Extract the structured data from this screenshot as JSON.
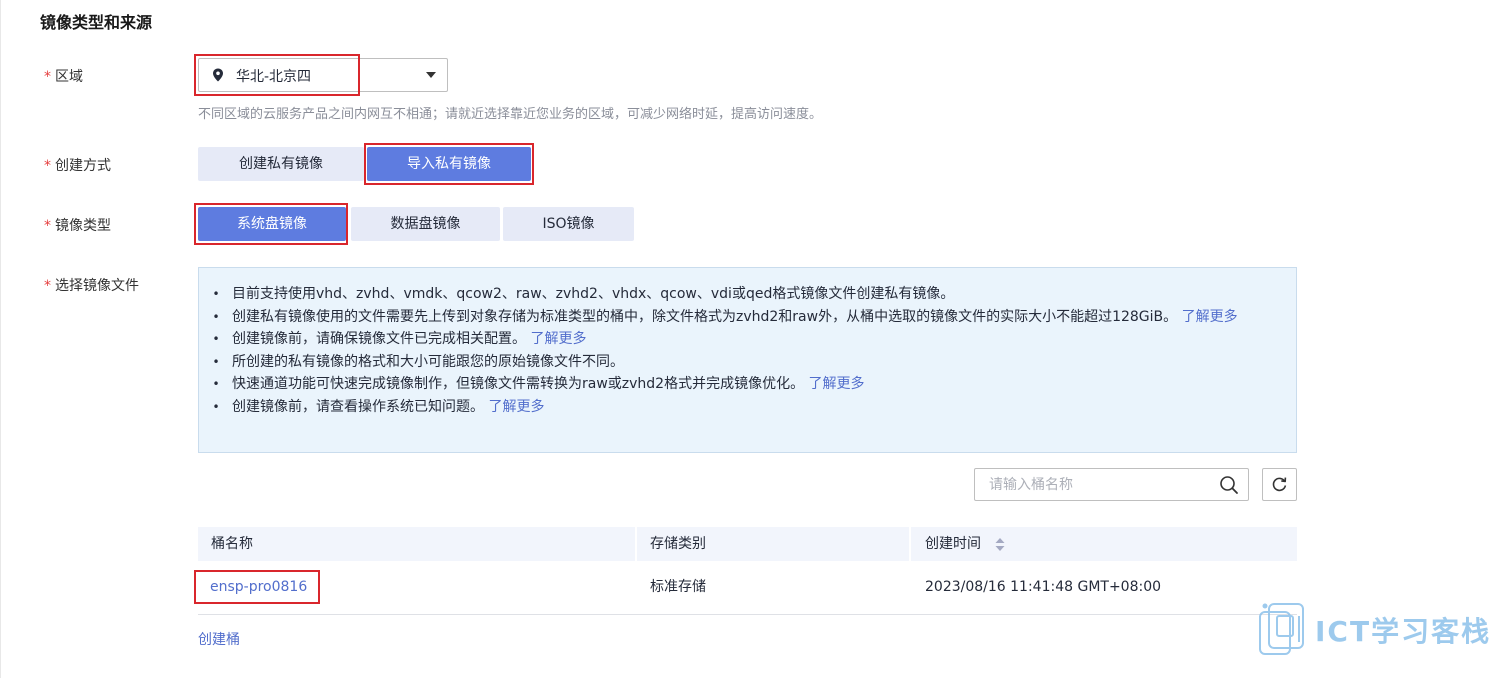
{
  "section_title": "镜像类型和来源",
  "required_mark": "*",
  "region": {
    "label": "区域",
    "value": "华北-北京四",
    "hint": "不同区域的云服务产品之间内网互不相通；请就近选择靠近您业务的区域，可减少网络时延，提高访问速度。"
  },
  "creation_method": {
    "label": "创建方式",
    "options": [
      "创建私有镜像",
      "导入私有镜像"
    ],
    "selected": "导入私有镜像"
  },
  "image_type": {
    "label": "镜像类型",
    "options": [
      "系统盘镜像",
      "数据盘镜像",
      "ISO镜像"
    ],
    "selected": "系统盘镜像"
  },
  "image_file": {
    "label": "选择镜像文件",
    "info_items": [
      {
        "text": "目前支持使用vhd、zvhd、vmdk、qcow2、raw、zvhd2、vhdx、qcow、vdi或qed格式镜像文件创建私有镜像。",
        "link": ""
      },
      {
        "text": "创建私有镜像使用的文件需要先上传到对象存储为标准类型的桶中，除文件格式为zvhd2和raw外，从桶中选取的镜像文件的实际大小不能超过128GiB。 ",
        "link": "了解更多"
      },
      {
        "text": "创建镜像前，请确保镜像文件已完成相关配置。 ",
        "link": "了解更多"
      },
      {
        "text": "所创建的私有镜像的格式和大小可能跟您的原始镜像文件不同。",
        "link": ""
      },
      {
        "text": "快速通道功能可快速完成镜像制作，但镜像文件需转换为raw或zvhd2格式并完成镜像优化。 ",
        "link": "了解更多"
      },
      {
        "text": "创建镜像前，请查看操作系统已知问题。 ",
        "link": "了解更多"
      }
    ]
  },
  "search": {
    "placeholder": "请输入桶名称",
    "value": ""
  },
  "table": {
    "columns": [
      "桶名称",
      "存储类别",
      "创建时间"
    ],
    "rows": [
      {
        "name": "ensp-pro0816",
        "storage_class": "标准存储",
        "created": "2023/08/16 11:41:48 GMT+08:00"
      }
    ]
  },
  "create_bucket_link": "创建桶",
  "watermark": "ICT学习客栈",
  "icons": {
    "region": "map-pin-icon",
    "dropdown": "caret-down-icon",
    "search": "search-icon",
    "refresh": "refresh-icon",
    "sort": "sort-icon"
  },
  "colors": {
    "primary": "#5e7ce0",
    "button_off": "#e6eaf7",
    "link": "#526ecc",
    "highlight_box": "#d9262c",
    "info_bg": "#eaf4fc",
    "required": "#e53e3e"
  }
}
